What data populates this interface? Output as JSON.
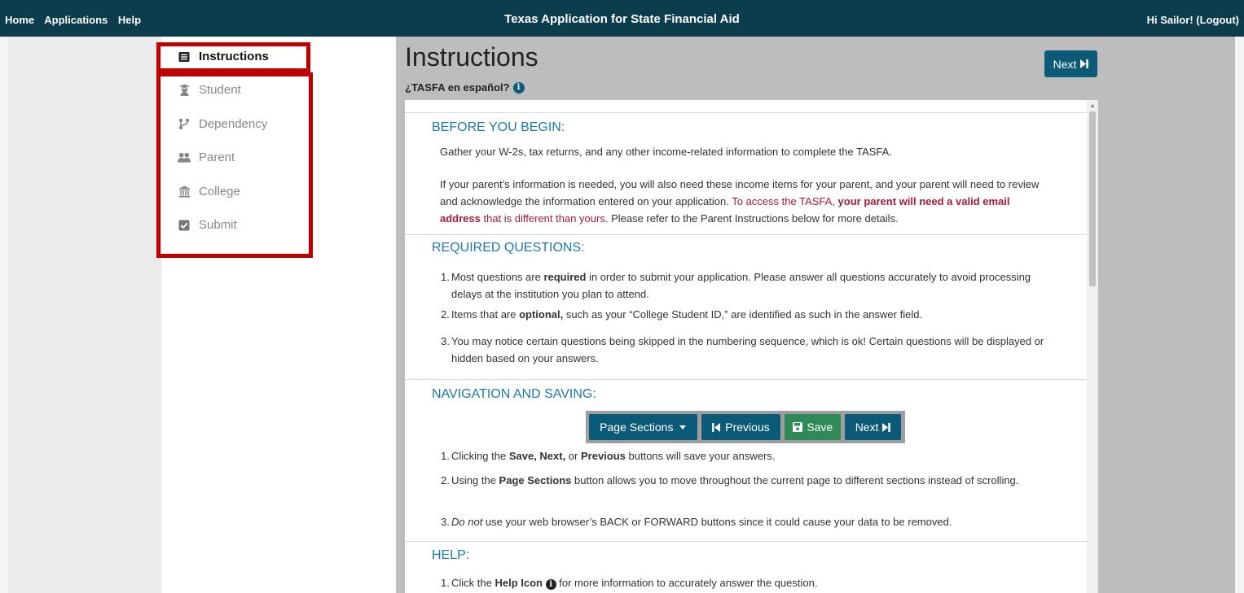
{
  "topbar": {
    "nav": [
      "Home",
      "Applications",
      "Help"
    ],
    "title": "Texas Application for State Financial Aid",
    "user": "Hi Sailor! (Logout)"
  },
  "sidebar": {
    "items": [
      {
        "label": "Instructions",
        "icon": "list-icon"
      },
      {
        "label": "Student",
        "icon": "graduate-icon"
      },
      {
        "label": "Dependency",
        "icon": "branch-icon"
      },
      {
        "label": "Parent",
        "icon": "users-icon"
      },
      {
        "label": "College",
        "icon": "institution-icon"
      },
      {
        "label": "Submit",
        "icon": "checkbox-icon"
      }
    ]
  },
  "main": {
    "title": "Instructions",
    "next_label": "Next",
    "espanol": "¿TASFA en español?"
  },
  "sections": {
    "before": {
      "title": "BEFORE YOU BEGIN:",
      "p1": "Gather your W-2s, tax returns, and any other income-related information to complete the TASFA.",
      "p2_a": "If your parent’s information is needed, you will also need these income items for your parent, and your parent will need to review and acknowledge the information entered on your application. ",
      "p2_red1": "To access the TASFA, ",
      "p2_bold": "your parent will need a valid email address",
      "p2_red2": " that is different than yours.",
      "p2_b": " Please refer to the Parent Instructions below for more details."
    },
    "required": {
      "title": "REQUIRED QUESTIONS:",
      "i1_a": "Most questions are ",
      "i1_bold": "required",
      "i1_b": " in order to submit your application. Please answer all questions accurately to avoid processing delays at the institution you plan to attend.",
      "i2_a": "Items that are ",
      "i2_bold": "optional,",
      "i2_b": " such as your “College Student ID,” are identified as such in the answer field.",
      "i3": "You may notice certain questions being skipped in the numbering sequence, which is ok! Certain questions will be displayed or hidden based on your answers."
    },
    "navigation": {
      "title": "NAVIGATION AND SAVING:",
      "buttons": {
        "sections": "Page Sections",
        "previous": "Previous",
        "save": "Save",
        "next": "Next"
      },
      "i1_a": "Clicking the ",
      "i1_bold1": "Save, Next,",
      "i1_mid": " or ",
      "i1_bold2": "Previous",
      "i1_b": " buttons will save your answers.",
      "i2_a": "Using the ",
      "i2_bold": "Page Sections",
      "i2_b": " button allows you to move throughout the current page to different sections instead of scrolling.",
      "i3_ital": "Do not",
      "i3_b": " use your web browser’s BACK or FORWARD buttons since it could cause your data to be removed."
    },
    "help": {
      "title": "HELP:",
      "i1_a": "Click the ",
      "i1_bold": "Help Icon",
      "i1_b": " for more information to accurately answer the question."
    }
  },
  "colors": {
    "topbar": "#0b3d4c",
    "primary": "#0b5a78",
    "accent_red": "#a31c3a",
    "highlight": "#c00000",
    "section_title": "#1a7ba8",
    "save_green": "#2e8b57"
  }
}
